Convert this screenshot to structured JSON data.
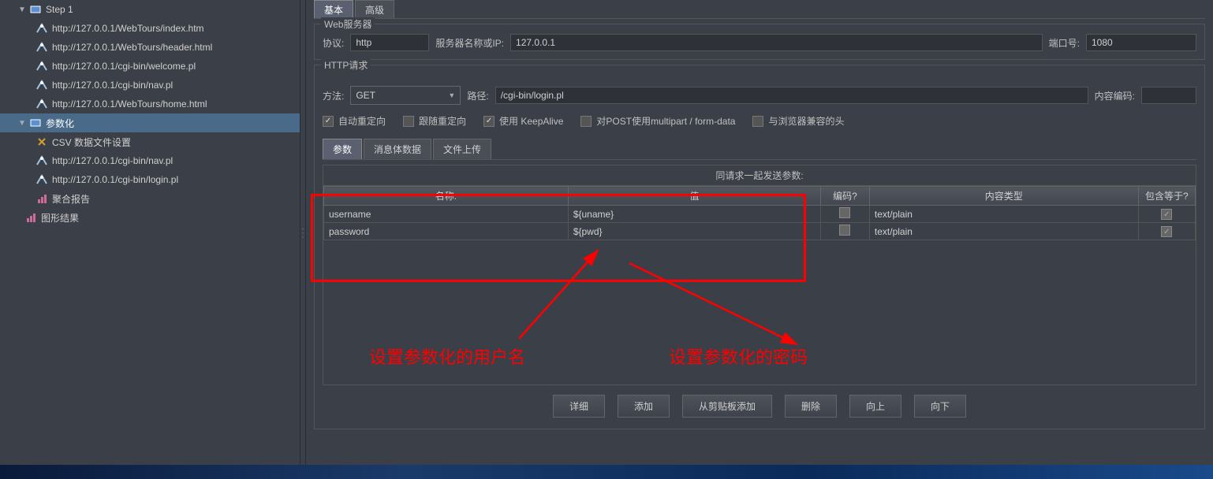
{
  "tree": {
    "step1": "Step 1",
    "items": [
      "http://127.0.0.1/WebTours/index.htm",
      "http://127.0.0.1/WebTours/header.html",
      "http://127.0.0.1/cgi-bin/welcome.pl",
      "http://127.0.0.1/cgi-bin/nav.pl",
      "http://127.0.0.1/WebTours/home.html"
    ],
    "param_node": "参数化",
    "csv_node": "CSV 数据文件设置",
    "param_children": [
      "http://127.0.0.1/cgi-bin/nav.pl",
      "http://127.0.0.1/cgi-bin/login.pl"
    ],
    "aggregate_report": "聚合报告",
    "graph_result": "图形结果"
  },
  "tabs": {
    "basic": "基本",
    "advanced": "高级"
  },
  "web_server": {
    "group": "Web服务器",
    "protocol_label": "协议:",
    "protocol_value": "http",
    "server_label": "服务器名称或IP:",
    "server_value": "127.0.0.1",
    "port_label": "端口号:",
    "port_value": "1080"
  },
  "http_request": {
    "group": "HTTP请求",
    "method_label": "方法:",
    "method_value": "GET",
    "path_label": "路径:",
    "path_value": "/cgi-bin/login.pl",
    "encoding_label": "内容编码:",
    "encoding_value": ""
  },
  "checkboxes": {
    "auto_redirect": "自动重定向",
    "follow_redirect": "跟随重定向",
    "keep_alive": "使用 KeepAlive",
    "multipart": "对POST使用multipart / form-data",
    "browser_headers": "与浏览器兼容的头"
  },
  "subtabs": {
    "params": "参数",
    "body": "消息体数据",
    "file": "文件上传"
  },
  "params": {
    "title": "同请求一起发送参数:",
    "headers": {
      "name": "名称:",
      "value": "值",
      "encode": "编码?",
      "type": "内容类型",
      "include": "包含等于?"
    },
    "rows": [
      {
        "name": "username",
        "value": "${uname}",
        "type": "text/plain"
      },
      {
        "name": "password",
        "value": "${pwd}",
        "type": "text/plain"
      }
    ]
  },
  "buttons": {
    "detail": "详细",
    "add": "添加",
    "add_clipboard": "从剪贴板添加",
    "delete": "删除",
    "up": "向上",
    "down": "向下"
  },
  "annotations": {
    "username_note": "设置参数化的用户名",
    "password_note": "设置参数化的密码"
  }
}
